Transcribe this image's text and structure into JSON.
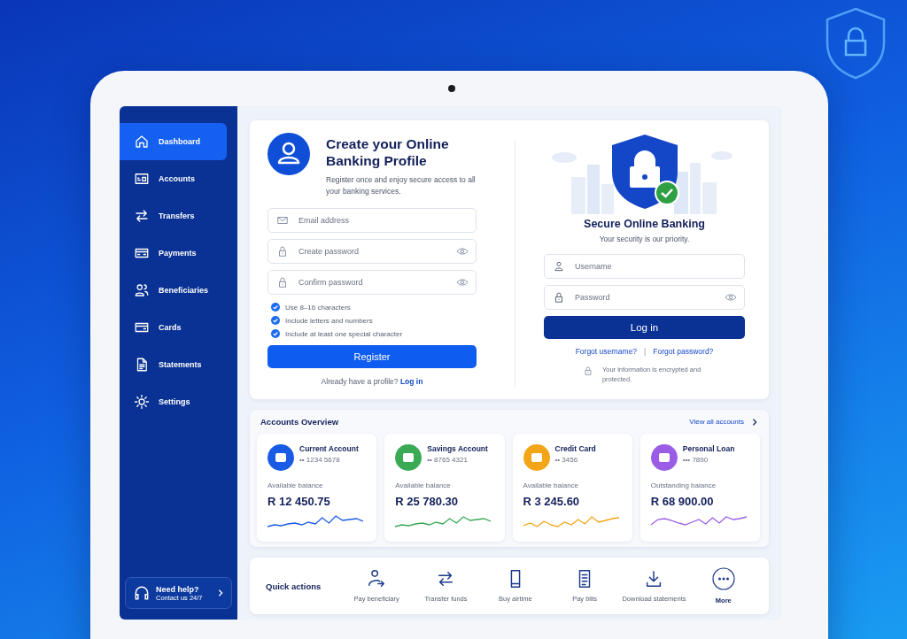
{
  "sidebar": {
    "items": [
      {
        "label": "Dashboard",
        "selected": true
      },
      {
        "label": "Accounts",
        "selected": false
      },
      {
        "label": "Transfers",
        "selected": false
      },
      {
        "label": "Payments",
        "selected": false
      },
      {
        "label": "Beneficiaries",
        "selected": false
      },
      {
        "label": "Cards",
        "selected": false
      },
      {
        "label": "Statements",
        "selected": false
      },
      {
        "label": "Settings",
        "selected": false
      }
    ],
    "help": {
      "title": "Need help?",
      "subtitle": "Contact us 24/7"
    }
  },
  "register": {
    "title": "Create your Online Banking Profile",
    "subtitle": "Register once and enjoy secure access to all your banking services.",
    "fields": [
      {
        "placeholder": "Email address",
        "kind": "email"
      },
      {
        "placeholder": "Create password",
        "kind": "password"
      },
      {
        "placeholder": "Confirm password",
        "kind": "password"
      }
    ],
    "rules": [
      {
        "text": "Use 8–16 characters",
        "checked": true
      },
      {
        "text": "Include letters and numbers",
        "checked": true
      },
      {
        "text": "Include at least one special character",
        "checked": true
      }
    ],
    "button": "Register",
    "footer": "Already have a profile?",
    "footer_link": "Log in"
  },
  "login": {
    "title": "Secure Online Banking",
    "subtitle": "Your security is our priority.",
    "fields": [
      {
        "placeholder": "Username",
        "kind": "user"
      },
      {
        "placeholder": "Password",
        "kind": "password"
      }
    ],
    "button": "Log in",
    "links": [
      "Forgot username?",
      "Forgot password?"
    ],
    "separator": "|",
    "note": "Your information is encrypted and protected."
  },
  "accounts": {
    "title": "Accounts Overview",
    "link": "View all accounts",
    "items": [
      {
        "name": "Current Account",
        "number": "•• 1234 5678",
        "label": "Available balance",
        "balance": "R 12 450.75",
        "color": "#1a5be6"
      },
      {
        "name": "Savings Account",
        "number": "•• 8765 4321",
        "label": "Available balance",
        "balance": "R 25 780.30",
        "color": "#3aaa55"
      },
      {
        "name": "Credit Card",
        "number": "•• 3456",
        "label": "Available balance",
        "balance": "R 3 245.60",
        "color": "#f2a516"
      },
      {
        "name": "Personal Loan",
        "number": "••• 7890",
        "label": "Outstanding balance",
        "balance": "R 68 900.00",
        "color": "#9b5de5"
      }
    ]
  },
  "quick_actions": {
    "title": "Quick actions",
    "items": [
      {
        "label": "Pay beneficiary",
        "kind": "action"
      },
      {
        "label": "Transfer funds",
        "kind": "action"
      },
      {
        "label": "Buy airtime",
        "kind": "action"
      },
      {
        "label": "Pay bills",
        "kind": "action"
      },
      {
        "label": "Download statements",
        "kind": "action"
      },
      {
        "label": "More",
        "kind": "more"
      }
    ]
  }
}
